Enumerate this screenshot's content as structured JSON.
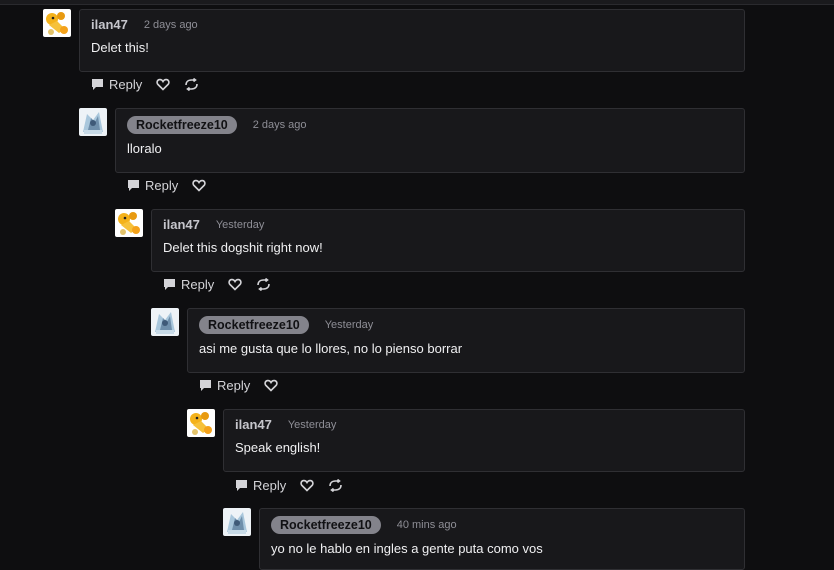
{
  "reply_label": "Reply",
  "comments": [
    {
      "author": "ilan47",
      "time": "2 days ago",
      "text": "Delet this!",
      "avatar": "yellow-character-avatar",
      "pill": false
    },
    {
      "author": "Rocketfreeze10",
      "time": "2 days ago",
      "text": "lloralo",
      "avatar": "ice-character-avatar",
      "pill": true
    },
    {
      "author": "ilan47",
      "time": "Yesterday",
      "text": "Delet this dogshit right now!",
      "avatar": "yellow-character-avatar",
      "pill": false
    },
    {
      "author": "Rocketfreeze10",
      "time": "Yesterday",
      "text": "asi me gusta que lo llores, no lo pienso borrar",
      "avatar": "ice-character-avatar",
      "pill": true
    },
    {
      "author": "ilan47",
      "time": "Yesterday",
      "text": "Speak english!",
      "avatar": "yellow-character-avatar",
      "pill": false
    },
    {
      "author": "Rocketfreeze10",
      "time": "40 mins ago",
      "text": "yo no le hablo en ingles a gente puta como vos",
      "avatar": "ice-character-avatar",
      "pill": true
    }
  ],
  "colors": {
    "background": "#0e0e10",
    "card": "#18181b",
    "pill": "#83838b"
  }
}
